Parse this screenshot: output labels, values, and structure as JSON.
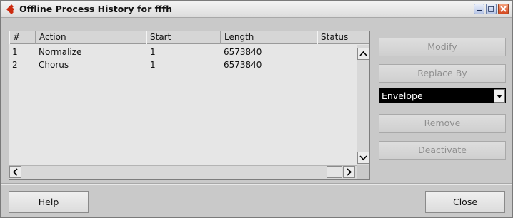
{
  "window": {
    "title": "Offline Process History for fffh",
    "colors": {
      "titlebar": "#e6e6e6",
      "logo": "#cc2a0e",
      "dropdown_bg": "#000000",
      "disabled_text": "#8e8e8e"
    }
  },
  "list": {
    "columns": [
      "#",
      "Action",
      "Start",
      "Length",
      "Status"
    ],
    "rows": [
      {
        "num": "1",
        "action": "Normalize",
        "start": "1",
        "length": "6573840",
        "status": ""
      },
      {
        "num": "2",
        "action": "Chorus",
        "start": "1",
        "length": "6573840",
        "status": ""
      }
    ]
  },
  "side": {
    "modify_label": "Modify",
    "replace_by_label": "Replace By",
    "replace_select_value": "Envelope",
    "remove_label": "Remove",
    "deactivate_label": "Deactivate"
  },
  "footer": {
    "help_label": "Help",
    "close_label": "Close"
  },
  "icons": [
    "cubase-logo-icon",
    "minimize-icon",
    "maximize-icon",
    "close-icon",
    "scroll-up-icon",
    "scroll-down-icon",
    "scroll-left-icon",
    "scroll-right-icon",
    "dropdown-arrow-icon"
  ]
}
